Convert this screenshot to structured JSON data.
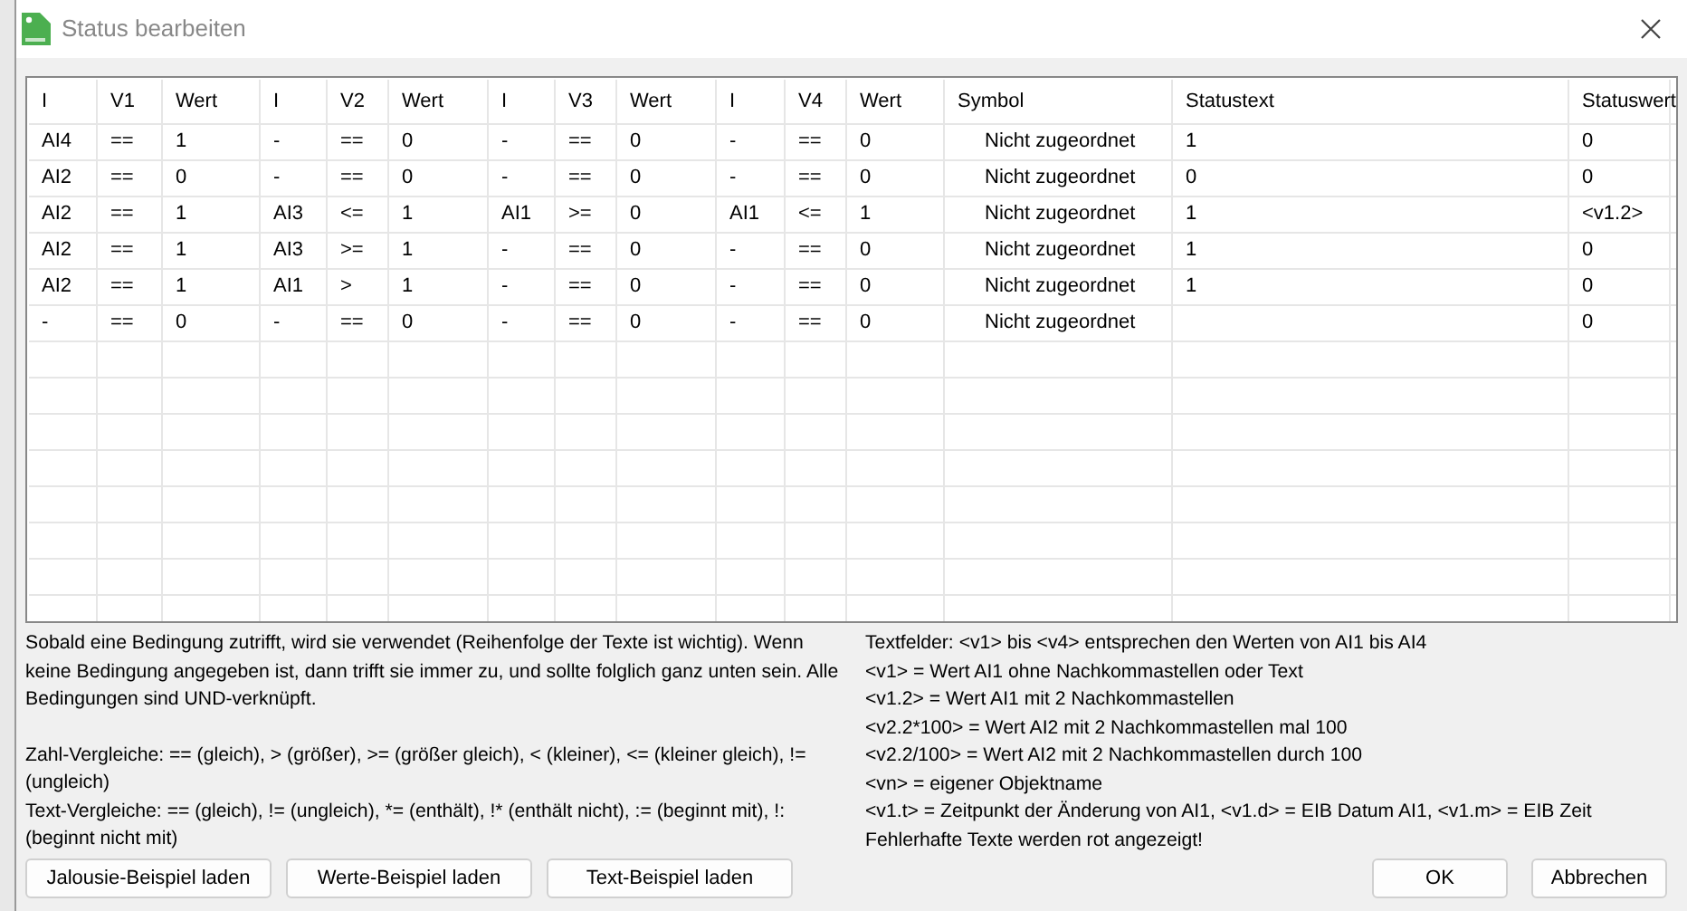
{
  "window": {
    "title": "Status bearbeiten"
  },
  "table": {
    "columns": [
      "I",
      "V1",
      "Wert",
      "I",
      "V2",
      "Wert",
      "I",
      "V3",
      "Wert",
      "I",
      "V4",
      "Wert",
      "Symbol",
      "Statustext",
      "Statuswert"
    ],
    "rows": [
      [
        "AI4",
        "==",
        "1",
        "-",
        "==",
        "0",
        "-",
        "==",
        "0",
        "-",
        "==",
        "0",
        "Nicht zugeordnet",
        "1",
        "0"
      ],
      [
        "AI2",
        "==",
        "0",
        "-",
        "==",
        "0",
        "-",
        "==",
        "0",
        "-",
        "==",
        "0",
        "Nicht zugeordnet",
        "0",
        "0"
      ],
      [
        "AI2",
        "==",
        "1",
        "AI3",
        "<=",
        "1",
        "AI1",
        ">=",
        "0",
        "AI1",
        "<=",
        "1",
        "Nicht zugeordnet",
        "1",
        "<v1.2>"
      ],
      [
        "AI2",
        "==",
        "1",
        "AI3",
        ">=",
        "1",
        "-",
        "==",
        "0",
        "-",
        "==",
        "0",
        "Nicht zugeordnet",
        "1",
        "0"
      ],
      [
        "AI2",
        "==",
        "1",
        "AI1",
        ">",
        "1",
        "-",
        "==",
        "0",
        "-",
        "==",
        "0",
        "Nicht zugeordnet",
        "1",
        "0"
      ],
      [
        "-",
        "==",
        "0",
        "-",
        "==",
        "0",
        "-",
        "==",
        "0",
        "-",
        "==",
        "0",
        "Nicht zugeordnet",
        null,
        "0"
      ]
    ]
  },
  "help_left": [
    "Sobald eine Bedingung zutrifft, wird sie verwendet (Reihenfolge der Texte ist wichtig). Wenn keine Bedingung angegeben ist, dann trifft sie immer zu, und sollte folglich ganz unten sein. Alle Bedingungen sind UND-verknüpft.",
    "Zahl-Vergleiche: == (gleich), > (größer), >= (größer gleich), < (kleiner), <= (kleiner gleich), != (ungleich)",
    "Text-Vergleiche: == (gleich), != (ungleich), *= (enthält), !* (enthält nicht), := (beginnt mit), !: (beginnt nicht mit)"
  ],
  "help_right": [
    "Textfelder: <v1> bis <v4> entsprechen den Werten von AI1 bis AI4",
    "<v1> = Wert AI1 ohne Nachkommastellen oder Text",
    "<v1.2> = Wert AI1 mit 2 Nachkommastellen",
    "<v2.2*100> = Wert AI2 mit 2 Nachkommastellen mal 100",
    "<v2.2/100> = Wert AI2 mit 2 Nachkommastellen durch 100",
    "<vn> = eigener Objektname",
    "<v1.t> = Zeitpunkt der Änderung von AI1, <v1.d> = EIB Datum AI1, <v1.m> = EIB Zeit",
    "Fehlerhafte Texte werden rot angezeigt!"
  ],
  "example_buttons": [
    "Jalousie-Beispiel laden",
    "Werte-Beispiel laden",
    "Text-Beispiel laden"
  ],
  "dialog_buttons": [
    "OK",
    "Abbrechen"
  ]
}
